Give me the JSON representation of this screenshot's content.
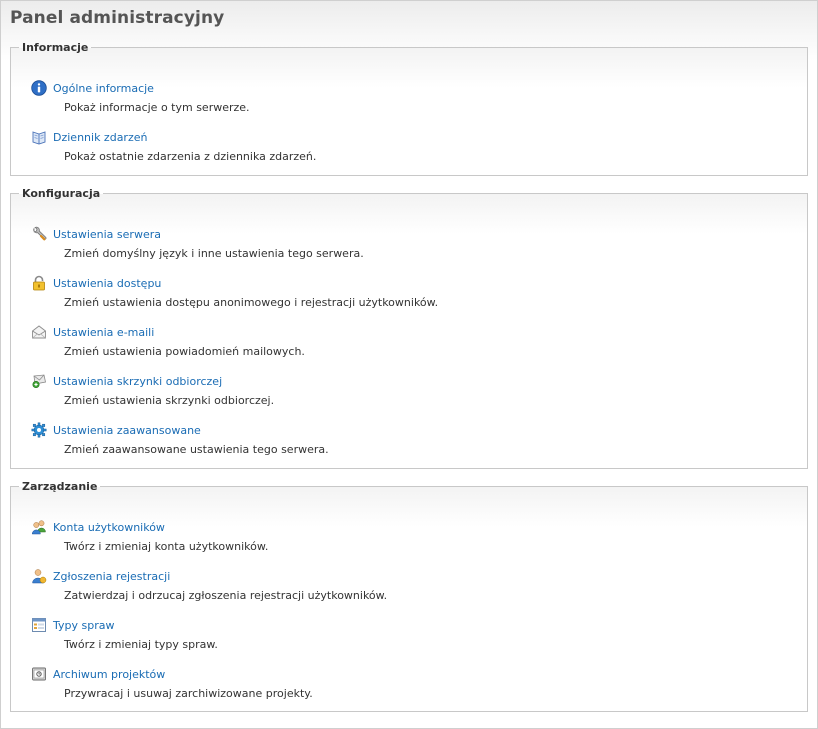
{
  "page": {
    "title": "Panel administracyjny"
  },
  "colors": {
    "link": "#1a6cb4",
    "text": "#333333",
    "border": "#c8c8c8"
  },
  "sections": [
    {
      "legend": "Informacje",
      "items": [
        {
          "icon": "info-icon",
          "label": "Ogólne informacje",
          "desc": "Pokaż informacje o tym serwerze."
        },
        {
          "icon": "book-icon",
          "label": "Dziennik zdarzeń",
          "desc": "Pokaż ostatnie zdarzenia z dziennika zdarzeń."
        }
      ]
    },
    {
      "legend": "Konfiguracja",
      "items": [
        {
          "icon": "wrench-icon",
          "label": "Ustawienia serwera",
          "desc": "Zmień domyślny język i inne ustawienia tego serwera."
        },
        {
          "icon": "padlock-icon",
          "label": "Ustawienia dostępu",
          "desc": "Zmień ustawienia dostępu anonimowego i rejestracji użytkowników."
        },
        {
          "icon": "envelope-icon",
          "label": "Ustawienia e-maili",
          "desc": "Zmień ustawienia powiadomień mailowych."
        },
        {
          "icon": "inbox-icon",
          "label": "Ustawienia skrzynki odbiorczej",
          "desc": "Zmień ustawienia skrzynki odbiorczej."
        },
        {
          "icon": "gear-icon",
          "label": "Ustawienia zaawansowane",
          "desc": "Zmień zaawansowane ustawienia tego serwera."
        }
      ]
    },
    {
      "legend": "Zarządzanie",
      "items": [
        {
          "icon": "users-icon",
          "label": "Konta użytkowników",
          "desc": "Twórz i zmieniaj konta użytkowników."
        },
        {
          "icon": "user-request-icon",
          "label": "Zgłoszenia rejestracji",
          "desc": "Zatwierdzaj i odrzucaj zgłoszenia rejestracji użytkowników."
        },
        {
          "icon": "form-icon",
          "label": "Typy spraw",
          "desc": "Twórz i zmieniaj typy spraw."
        },
        {
          "icon": "archive-icon",
          "label": "Archiwum projektów",
          "desc": "Przywracaj i usuwaj zarchiwizowane projekty."
        }
      ]
    }
  ]
}
